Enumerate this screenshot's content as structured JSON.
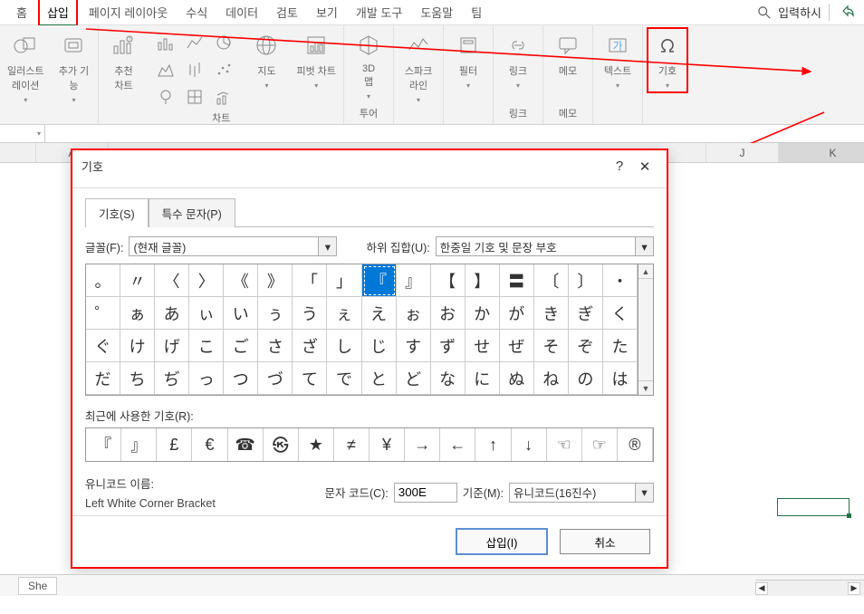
{
  "tabs": {
    "items": [
      "홈",
      "삽입",
      "페이지 레이아웃",
      "수식",
      "데이터",
      "검토",
      "보기",
      "개발 도구",
      "도움말",
      "팀"
    ],
    "active_index": 1,
    "search_placeholder": "입력하시",
    "share_icon": "share-icon"
  },
  "ribbon": {
    "groups": [
      {
        "label": "",
        "items": [
          {
            "name": "illustrations",
            "label": "일러스트\n레이션"
          },
          {
            "name": "addins",
            "label": "추가 기\n능"
          }
        ]
      },
      {
        "label": "차트",
        "items": [
          {
            "name": "recommended-charts",
            "label": "추천\n차트"
          },
          {
            "name": "charts-gallery",
            "mini": true
          },
          {
            "name": "maps",
            "label": "지도"
          },
          {
            "name": "pivot-chart",
            "label": "피벗 차트"
          }
        ]
      },
      {
        "label": "투어",
        "items": [
          {
            "name": "3d-map",
            "label": "3D\n맵"
          }
        ]
      },
      {
        "label": "",
        "items": [
          {
            "name": "sparklines",
            "label": "스파크\n라인"
          }
        ]
      },
      {
        "label": "",
        "items": [
          {
            "name": "filter",
            "label": "필터"
          }
        ]
      },
      {
        "label": "링크",
        "items": [
          {
            "name": "link",
            "label": "링크"
          }
        ]
      },
      {
        "label": "메모",
        "items": [
          {
            "name": "memo",
            "label": "메모"
          }
        ]
      },
      {
        "label": "",
        "items": [
          {
            "name": "textbox",
            "label": "텍스트"
          }
        ]
      },
      {
        "label": "",
        "items": [
          {
            "name": "symbol",
            "label": "기호",
            "highlight": true
          }
        ]
      }
    ]
  },
  "worksheet": {
    "columns": [
      "",
      "A",
      "",
      "",
      "",
      "",
      "",
      "",
      "",
      "",
      "J",
      "K"
    ]
  },
  "symbol_dialog": {
    "title": "기호",
    "tabs": [
      "기호(S)",
      "특수 문자(P)"
    ],
    "font_label": "글꼴(F):",
    "font_value": "(현재 글꼴)",
    "subset_label": "하위 집합(U):",
    "subset_value": "한중일 기호 및 문장 부호",
    "grid": [
      [
        "。",
        "〃",
        "〈",
        "〉",
        "《",
        "》",
        "「",
        "」",
        "『",
        "』",
        "【",
        "】",
        "〓",
        "〔",
        "〕",
        "・"
      ],
      [
        "゜",
        "ぁ",
        "あ",
        "ぃ",
        "い",
        "ぅ",
        "う",
        "ぇ",
        "え",
        "ぉ",
        "お",
        "か",
        "が",
        "き",
        "ぎ",
        "く"
      ],
      [
        "ぐ",
        "け",
        "げ",
        "こ",
        "ご",
        "さ",
        "ざ",
        "し",
        "じ",
        "す",
        "ず",
        "せ",
        "ぜ",
        "そ",
        "ぞ",
        "た"
      ],
      [
        "だ",
        "ち",
        "ぢ",
        "っ",
        "つ",
        "づ",
        "て",
        "で",
        "と",
        "ど",
        "な",
        "に",
        "ぬ",
        "ね",
        "の",
        "は"
      ]
    ],
    "selected_row": 0,
    "selected_col": 8,
    "recent_label": "최근에 사용한 기호(R):",
    "recent": [
      "『",
      "』",
      "£",
      "€",
      "☎",
      "㉿",
      "★",
      "≠",
      "¥",
      "→",
      "←",
      "↑",
      "↓",
      "☜",
      "☞",
      "®"
    ],
    "unicode_label": "유니코드 이름:",
    "unicode_name": "Left White Corner Bracket",
    "code_label": "문자 코드(C):",
    "code_value": "300E",
    "basis_label": "기준(M):",
    "basis_value": "유니코드(16진수)",
    "insert_btn": "삽입(I)",
    "cancel_btn": "취소"
  },
  "sheet_tab": {
    "name": "She"
  }
}
